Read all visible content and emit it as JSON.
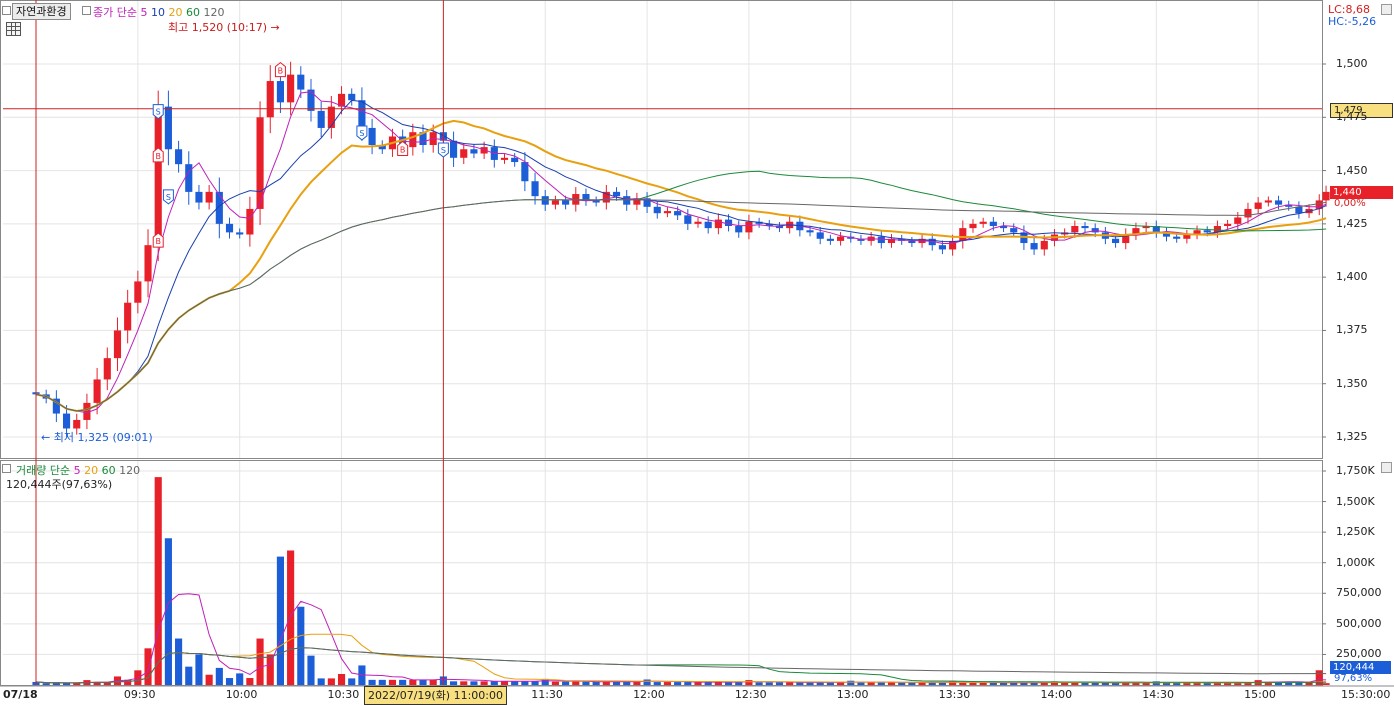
{
  "toolbar": {
    "chart_mode_button": "자연과환경",
    "price_legend": {
      "label": "종가 단순",
      "periods": [
        "5",
        "10",
        "20",
        "60",
        "120"
      ]
    },
    "volume_legend": {
      "label": "거래량 단순",
      "periods": [
        "5",
        "20",
        "60",
        "120"
      ]
    },
    "volume_readout": "120,444주(97,63%)"
  },
  "info": {
    "lc": "LC:8,68",
    "hc": "HC:-5,26"
  },
  "annotations": {
    "high": "최고 1,520 (10:17)",
    "low": "최저 1,325 (09:01)",
    "signal_buy": "B",
    "signal_sell": "S"
  },
  "crosshair": {
    "price_label": "1,479",
    "time_label": "2022/07/19(화) 11:00:00"
  },
  "current": {
    "price_label": "1,440",
    "change_label": "0,00%",
    "volume_label": "120,444",
    "volume_pct_label": "97,63%"
  },
  "price_axis_labels": [
    "1,500",
    "1,475",
    "1,450",
    "1,425",
    "1,400",
    "1,375",
    "1,350",
    "1,325"
  ],
  "volume_axis_labels": [
    "1,750K",
    "1,500K",
    "1,250K",
    "1,000K",
    "750,000",
    "500,000",
    "250,000"
  ],
  "time_axis": {
    "date": "07/18",
    "labels": [
      "09:30",
      "10:00",
      "10:30",
      "11:30",
      "12:00",
      "12:30",
      "13:00",
      "13:30",
      "14:00",
      "14:30",
      "15:00",
      "15:30:00"
    ]
  },
  "colors": {
    "up": "#e8202a",
    "down": "#1c5ed8",
    "ma5": "#c020b8",
    "ma10": "#1a3fb0",
    "ma20": "#e8a010",
    "ma60": "#1a8a3a",
    "ma120": "#666666",
    "crosshair": "#cc2222",
    "grid": "#e4e4e4",
    "current_bg": "#e8202a",
    "crosshair_bg": "#f8e080",
    "volume_tag_bg": "#1c5ed8"
  },
  "chart_data": {
    "type": "candlestick",
    "date": "07/18",
    "interval_min": 3,
    "series": [
      {
        "name": "종가",
        "markers": "OHLC candles"
      },
      {
        "name": "단순 5"
      },
      {
        "name": "단순 10"
      },
      {
        "name": "단순 20"
      },
      {
        "name": "단순 60"
      },
      {
        "name": "단순 120"
      }
    ],
    "price_ylim": [
      1315,
      1530
    ],
    "volume_ylim": [
      0,
      1800000
    ],
    "high": {
      "value": 1520,
      "time": "10:17"
    },
    "low": {
      "value": 1325,
      "time": "09:01"
    },
    "last": {
      "value": 1440,
      "volume": 120444
    },
    "crosshair": {
      "price": 1479,
      "time": "11:00"
    },
    "grid": true,
    "close_path": [
      [
        "09:00",
        1345
      ],
      [
        "09:03",
        1343
      ],
      [
        "09:06",
        1336
      ],
      [
        "09:09",
        1329
      ],
      [
        "09:12",
        1333
      ],
      [
        "09:15",
        1341
      ],
      [
        "09:18",
        1352
      ],
      [
        "09:21",
        1362
      ],
      [
        "09:24",
        1375
      ],
      [
        "09:27",
        1388
      ],
      [
        "09:30",
        1398
      ],
      [
        "09:33",
        1415
      ],
      [
        "09:36",
        1480
      ],
      [
        "09:39",
        1460
      ],
      [
        "09:42",
        1453
      ],
      [
        "09:45",
        1440
      ],
      [
        "09:48",
        1435
      ],
      [
        "09:51",
        1440
      ],
      [
        "09:54",
        1425
      ],
      [
        "09:57",
        1421
      ],
      [
        "10:00",
        1420
      ],
      [
        "10:03",
        1432
      ],
      [
        "10:06",
        1475
      ],
      [
        "10:09",
        1492
      ],
      [
        "10:12",
        1482
      ],
      [
        "10:15",
        1495
      ],
      [
        "10:18",
        1488
      ],
      [
        "10:21",
        1478
      ],
      [
        "10:24",
        1470
      ],
      [
        "10:27",
        1480
      ],
      [
        "10:30",
        1486
      ],
      [
        "10:33",
        1483
      ],
      [
        "10:36",
        1470
      ],
      [
        "10:39",
        1462
      ],
      [
        "10:42",
        1460
      ],
      [
        "10:45",
        1466
      ],
      [
        "10:48",
        1461
      ],
      [
        "10:51",
        1468
      ],
      [
        "10:54",
        1462
      ],
      [
        "10:57",
        1468
      ],
      [
        "11:00",
        1464
      ],
      [
        "11:03",
        1456
      ],
      [
        "11:06",
        1460
      ],
      [
        "11:09",
        1458
      ],
      [
        "11:12",
        1461
      ],
      [
        "11:15",
        1455
      ],
      [
        "11:18",
        1456
      ],
      [
        "11:21",
        1454
      ],
      [
        "11:24",
        1445
      ],
      [
        "11:27",
        1438
      ],
      [
        "11:30",
        1434
      ],
      [
        "11:33",
        1436
      ],
      [
        "11:36",
        1434
      ],
      [
        "11:39",
        1439
      ],
      [
        "11:42",
        1436
      ],
      [
        "11:45",
        1435
      ],
      [
        "11:48",
        1440
      ],
      [
        "11:51",
        1438
      ],
      [
        "11:54",
        1434
      ],
      [
        "11:57",
        1437
      ],
      [
        "12:00",
        1433
      ],
      [
        "12:03",
        1430
      ],
      [
        "12:06",
        1431
      ],
      [
        "12:09",
        1429
      ],
      [
        "12:12",
        1425
      ],
      [
        "12:15",
        1426
      ],
      [
        "12:18",
        1423
      ],
      [
        "12:21",
        1427
      ],
      [
        "12:24",
        1424
      ],
      [
        "12:27",
        1421
      ],
      [
        "12:30",
        1426
      ],
      [
        "12:33",
        1425
      ],
      [
        "12:36",
        1424
      ],
      [
        "12:39",
        1423
      ],
      [
        "12:42",
        1426
      ],
      [
        "12:45",
        1422
      ],
      [
        "12:48",
        1421
      ],
      [
        "12:51",
        1418
      ],
      [
        "12:54",
        1417
      ],
      [
        "12:57",
        1419
      ],
      [
        "13:00",
        1418
      ],
      [
        "13:03",
        1417
      ],
      [
        "13:06",
        1419
      ],
      [
        "13:09",
        1416
      ],
      [
        "13:12",
        1418
      ],
      [
        "13:15",
        1417
      ],
      [
        "13:18",
        1416
      ],
      [
        "13:21",
        1418
      ],
      [
        "13:24",
        1415
      ],
      [
        "13:27",
        1413
      ],
      [
        "13:30",
        1417
      ],
      [
        "13:33",
        1423
      ],
      [
        "13:36",
        1425
      ],
      [
        "13:39",
        1426
      ],
      [
        "13:42",
        1424
      ],
      [
        "13:45",
        1423
      ],
      [
        "13:48",
        1421
      ],
      [
        "13:51",
        1416
      ],
      [
        "13:54",
        1413
      ],
      [
        "13:57",
        1417
      ],
      [
        "14:00",
        1420
      ],
      [
        "14:03",
        1421
      ],
      [
        "14:06",
        1424
      ],
      [
        "14:09",
        1423
      ],
      [
        "14:12",
        1421
      ],
      [
        "14:15",
        1418
      ],
      [
        "14:18",
        1416
      ],
      [
        "14:21",
        1420
      ],
      [
        "14:24",
        1423
      ],
      [
        "14:27",
        1424
      ],
      [
        "14:30",
        1421
      ],
      [
        "14:33",
        1419
      ],
      [
        "14:36",
        1418
      ],
      [
        "14:39",
        1420
      ],
      [
        "14:42",
        1422
      ],
      [
        "14:45",
        1421
      ],
      [
        "14:48",
        1424
      ],
      [
        "14:51",
        1425
      ],
      [
        "14:54",
        1428
      ],
      [
        "14:57",
        1432
      ],
      [
        "15:00",
        1435
      ],
      [
        "15:03",
        1436
      ],
      [
        "15:06",
        1434
      ],
      [
        "15:09",
        1433
      ],
      [
        "15:12",
        1430
      ],
      [
        "15:15",
        1432
      ],
      [
        "15:18",
        1436
      ],
      [
        "15:20",
        1440
      ]
    ],
    "volume_peaks": [
      [
        "09:00",
        25000
      ],
      [
        "09:15",
        40000
      ],
      [
        "09:24",
        70000
      ],
      [
        "09:30",
        120000
      ],
      [
        "09:33",
        300000
      ],
      [
        "09:36",
        1700000
      ],
      [
        "09:39",
        1200000
      ],
      [
        "09:42",
        380000
      ],
      [
        "09:48",
        250000
      ],
      [
        "09:54",
        140000
      ],
      [
        "10:00",
        95000
      ],
      [
        "10:06",
        380000
      ],
      [
        "10:09",
        250000
      ],
      [
        "10:12",
        1050000
      ],
      [
        "10:15",
        1100000
      ],
      [
        "10:18",
        640000
      ],
      [
        "10:21",
        240000
      ],
      [
        "10:30",
        90000
      ],
      [
        "10:36",
        160000
      ],
      [
        "11:00",
        70000
      ],
      [
        "11:30",
        50000
      ],
      [
        "12:00",
        45000
      ],
      [
        "12:30",
        40000
      ],
      [
        "13:00",
        35000
      ],
      [
        "13:30",
        35000
      ],
      [
        "14:00",
        30000
      ],
      [
        "14:30",
        30000
      ],
      [
        "15:00",
        40000
      ],
      [
        "15:18",
        120444
      ]
    ]
  }
}
